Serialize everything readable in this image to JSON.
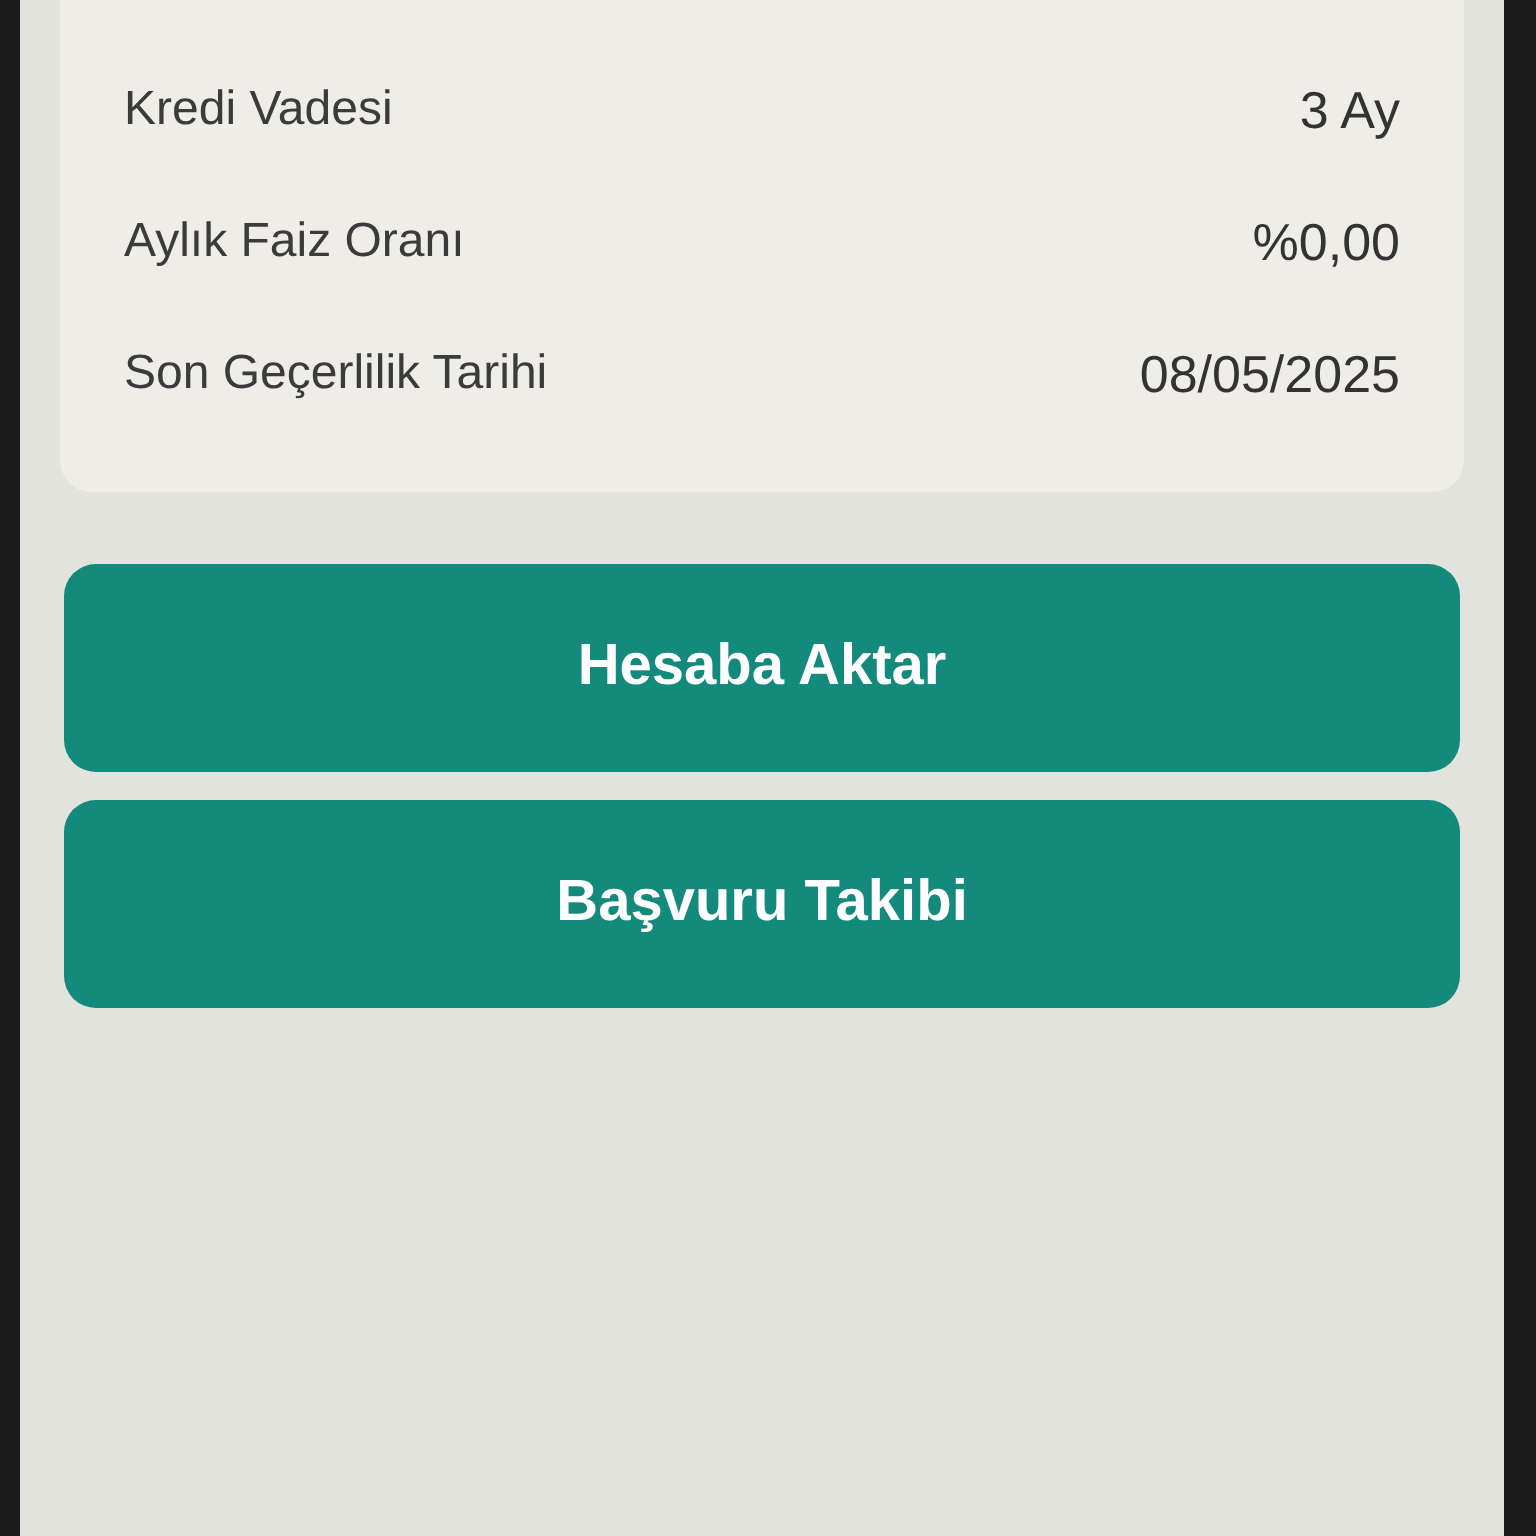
{
  "details": [
    {
      "label": "Kredi Vadesi",
      "value": "3 Ay"
    },
    {
      "label": "Aylık Faiz Oranı",
      "value": "%0,00"
    },
    {
      "label": "Son Geçerlilik Tarihi",
      "value": "08/05/2025"
    }
  ],
  "buttons": [
    {
      "label": "Hesaba Aktar"
    },
    {
      "label": "Başvuru Takibi"
    }
  ]
}
